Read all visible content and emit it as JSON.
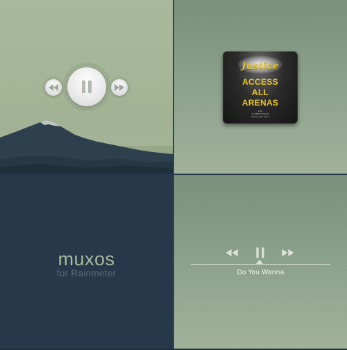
{
  "colors": {
    "sage_light": "#a9b99c",
    "sage_mid": "#8aa08a",
    "navy": "#27384a",
    "mountain": "#2d3f4c",
    "album_text": "#e8c62c",
    "control_icon": "#9aa49a"
  },
  "top_left": {
    "controls": {
      "previous_icon": "rewind-icon",
      "play_pause_icon": "pause-icon",
      "next_icon": "fast-forward-icon"
    }
  },
  "top_right": {
    "album": {
      "brand": "Justice",
      "title_lines": [
        "ACCESS",
        "ALL",
        "ARENAS"
      ],
      "fine_print": [
        "LIVE",
        "AT ZENITH PARIS",
        "ON 19 JULY 2012"
      ]
    }
  },
  "bottom_left": {
    "title": "muxos",
    "subtitle": "for Rainmeter"
  },
  "bottom_right": {
    "controls": {
      "previous_icon": "rewind-icon",
      "play_pause_icon": "pause-icon",
      "next_icon": "fast-forward-icon"
    },
    "track": "Do You Wanna"
  }
}
